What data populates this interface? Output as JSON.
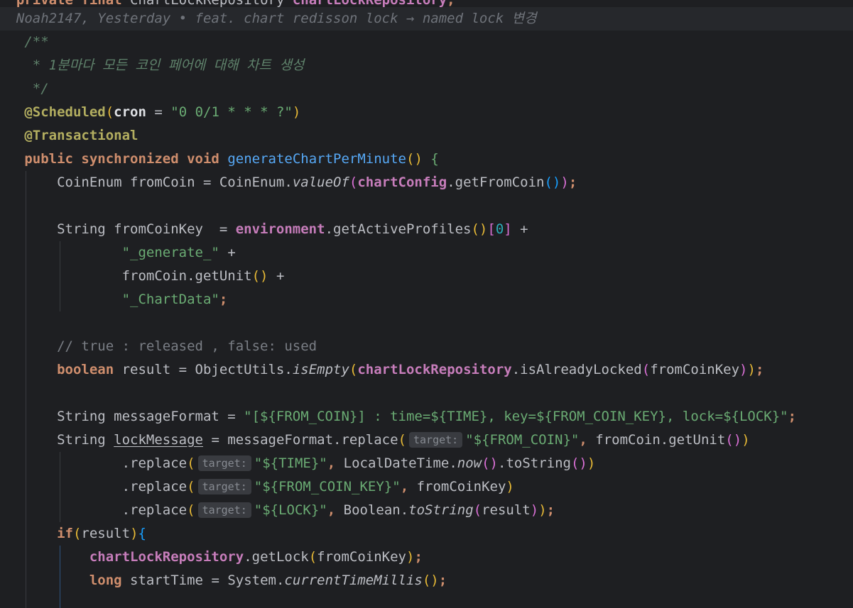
{
  "editor": {
    "language": "Java",
    "top_partial_line": "private final ChartLockRepository chartLockRepository;",
    "blame": "Noah2147, Yesterday • feat. chart redisson lock → named lock 변경",
    "doc_comment": [
      "/**",
      " * 1분마다 모든 코인 페어에 대해 차트 생성",
      " */"
    ],
    "annotations": {
      "scheduled": "@Scheduled",
      "cron_key": "cron",
      "cron_value": "\"0 0/1 * * * ?\"",
      "transactional": "@Transactional"
    },
    "method_signature": {
      "modifiers": "public synchronized void",
      "name": "generateChartPerMinute"
    },
    "comment_line": "// true : released , false: used",
    "inlay_hint": "target:",
    "strings": {
      "generate": "\"_generate_\"",
      "chart_data": "\"_ChartData\"",
      "message_format": "\"[${FROM_COIN}] : time=${TIME}, key=${FROM_COIN_KEY}, lock=${LOCK}\"",
      "from_coin": "\"${FROM_COIN}\"",
      "time": "\"${TIME}\"",
      "from_coin_key": "\"${FROM_COIN_KEY}\"",
      "lock": "\"${LOCK}\""
    },
    "colors": {
      "background": "#1e1f22",
      "keyword": "#cf8e6d",
      "string": "#6aab73",
      "annotation": "#b3ae60",
      "field": "#c77dbb",
      "comment": "#7a7e85"
    }
  }
}
